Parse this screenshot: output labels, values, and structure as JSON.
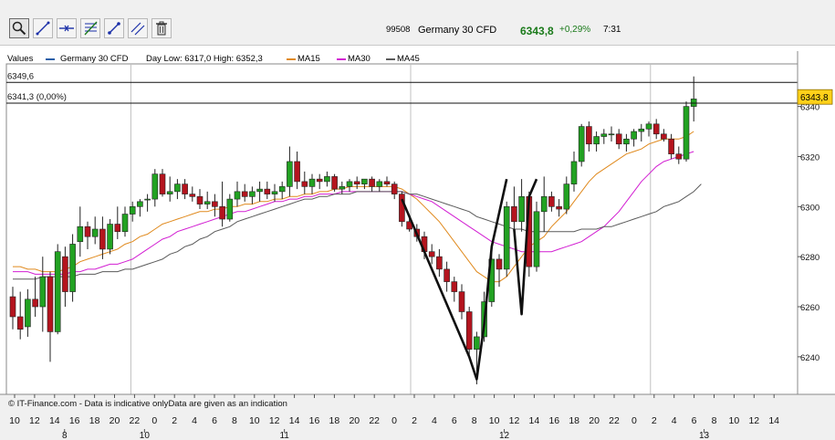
{
  "toolbar": {
    "buttons": [
      {
        "icon": "zoom-select-icon",
        "active": true
      },
      {
        "icon": "trend-line-icon",
        "active": false
      },
      {
        "icon": "horizontal-line-icon",
        "active": false
      },
      {
        "icon": "fibonacci-icon",
        "active": false
      },
      {
        "icon": "zoom-extents-icon",
        "active": false
      },
      {
        "icon": "channel-icon",
        "active": false
      },
      {
        "icon": "trash-icon",
        "active": false
      }
    ]
  },
  "quote": {
    "id": "99508",
    "name": "Germany 30 CFD",
    "last": "6343,8",
    "change": "+0,29%",
    "time": "7:31"
  },
  "legend": {
    "values_label": "Values",
    "instrument": "Germany 30 CFD",
    "day_range": "Day Low: 6317,0 High: 6352,3",
    "ma15": "MA15",
    "ma30": "MA30",
    "ma45": "MA45"
  },
  "colors": {
    "up_candle": "#22a222",
    "down_candle": "#b4141e",
    "ma15": "#e08a1e",
    "ma30": "#d21ed2",
    "ma45": "#5a5a5a",
    "instrument": "#2a5fa8",
    "price_box": "#ffd11a",
    "annotation": "#101010"
  },
  "chart_data": {
    "type": "candlestick",
    "title": "Germany 30 CFD",
    "ylim": [
      6225,
      6357
    ],
    "y_ticks": [
      6240,
      6260,
      6280,
      6300,
      6320,
      6340
    ],
    "grid": true,
    "price_labels": {
      "current": "6343,8",
      "level_high": "6349,6",
      "level_ref": "6341,3 (0,00%)"
    },
    "reference_lines": [
      6349.6,
      6341.3
    ],
    "x_tick_labels": [
      "10",
      "12",
      "14",
      "16",
      "18",
      "20",
      "22",
      "0",
      "2",
      "4",
      "6",
      "8",
      "10",
      "12",
      "14",
      "16",
      "18",
      "20",
      "22",
      "0",
      "2",
      "4",
      "6",
      "8",
      "10",
      "12",
      "14",
      "16",
      "18",
      "20",
      "22",
      "0",
      "2",
      "4",
      "6",
      "8",
      "10",
      "12",
      "14"
    ],
    "day_labels": [
      {
        "label": "8",
        "tick_index": 2.5
      },
      {
        "label": "10",
        "tick_index": 6.5
      },
      {
        "label": "11",
        "tick_index": 13.5
      },
      {
        "label": "12",
        "tick_index": 24.5
      },
      {
        "label": "13",
        "tick_index": 34.5
      }
    ],
    "session_breaks": [
      6,
      20,
      32
    ],
    "candles": [
      [
        6264,
        6268,
        6251,
        6256
      ],
      [
        6256,
        6266,
        6247,
        6251
      ],
      [
        6252,
        6267,
        6248,
        6263
      ],
      [
        6263,
        6272,
        6256,
        6260
      ],
      [
        6260,
        6280,
        6250,
        6272
      ],
      [
        6272,
        6274,
        6238,
        6250
      ],
      [
        6250,
        6285,
        6249,
        6282
      ],
      [
        6280,
        6284,
        6260,
        6266
      ],
      [
        6266,
        6289,
        6262,
        6285
      ],
      [
        6286,
        6300,
        6280,
        6292
      ],
      [
        6292,
        6294,
        6283,
        6288
      ],
      [
        6288,
        6296,
        6285,
        6291
      ],
      [
        6291,
        6296,
        6279,
        6283
      ],
      [
        6283,
        6295,
        6281,
        6293
      ],
      [
        6293,
        6300,
        6287,
        6290
      ],
      [
        6290,
        6300,
        6288,
        6297
      ],
      [
        6297,
        6302,
        6294,
        6300
      ],
      [
        6300,
        6303,
        6296,
        6302
      ],
      [
        6303,
        6305,
        6298,
        6303
      ],
      [
        6303,
        6315,
        6300,
        6313
      ],
      [
        6313,
        6315,
        6304,
        6305
      ],
      [
        6305,
        6312,
        6302,
        6306
      ],
      [
        6306,
        6311,
        6303,
        6309
      ],
      [
        6309,
        6311,
        6303,
        6305
      ],
      [
        6305,
        6308,
        6302,
        6304
      ],
      [
        6304,
        6307,
        6299,
        6301
      ],
      [
        6301,
        6306,
        6299,
        6302
      ],
      [
        6302,
        6305,
        6296,
        6300
      ],
      [
        6300,
        6310,
        6292,
        6295
      ],
      [
        6295,
        6305,
        6294,
        6303
      ],
      [
        6303,
        6310,
        6300,
        6306
      ],
      [
        6306,
        6309,
        6302,
        6304
      ],
      [
        6304,
        6308,
        6301,
        6306
      ],
      [
        6306,
        6310,
        6302,
        6307
      ],
      [
        6307,
        6310,
        6303,
        6305
      ],
      [
        6305,
        6309,
        6302,
        6306
      ],
      [
        6306,
        6310,
        6303,
        6308
      ],
      [
        6308,
        6324,
        6304,
        6318
      ],
      [
        6318,
        6322,
        6307,
        6310
      ],
      [
        6310,
        6314,
        6305,
        6308
      ],
      [
        6308,
        6313,
        6305,
        6311
      ],
      [
        6311,
        6313,
        6307,
        6310
      ],
      [
        6310,
        6314,
        6308,
        6312
      ],
      [
        6312,
        6313,
        6306,
        6307
      ],
      [
        6307,
        6310,
        6305,
        6308
      ],
      [
        6308,
        6311,
        6306,
        6310
      ],
      [
        6310,
        6312,
        6307,
        6309
      ],
      [
        6309,
        6311,
        6307,
        6311
      ],
      [
        6311,
        6312,
        6306,
        6308
      ],
      [
        6308,
        6311,
        6306,
        6310
      ],
      [
        6310,
        6312,
        6308,
        6309
      ],
      [
        6309,
        6310,
        6303,
        6305
      ],
      [
        6305,
        6306,
        6292,
        6294
      ],
      [
        6294,
        6296,
        6290,
        6291
      ],
      [
        6291,
        6293,
        6286,
        6288
      ],
      [
        6288,
        6290,
        6279,
        6282
      ],
      [
        6282,
        6285,
        6277,
        6280
      ],
      [
        6280,
        6283,
        6272,
        6275
      ],
      [
        6275,
        6278,
        6266,
        6270
      ],
      [
        6270,
        6272,
        6262,
        6266
      ],
      [
        6266,
        6269,
        6255,
        6258
      ],
      [
        6258,
        6260,
        6240,
        6243
      ],
      [
        6243,
        6250,
        6229,
        6248
      ],
      [
        6248,
        6266,
        6246,
        6262
      ],
      [
        6262,
        6282,
        6260,
        6279
      ],
      [
        6279,
        6281,
        6268,
        6275
      ],
      [
        6275,
        6302,
        6272,
        6300
      ],
      [
        6300,
        6308,
        6288,
        6294
      ],
      [
        6294,
        6311,
        6290,
        6304
      ],
      [
        6304,
        6306,
        6272,
        6276
      ],
      [
        6276,
        6302,
        6274,
        6298
      ],
      [
        6298,
        6312,
        6290,
        6304
      ],
      [
        6304,
        6306,
        6298,
        6300
      ],
      [
        6300,
        6303,
        6296,
        6299
      ],
      [
        6299,
        6312,
        6297,
        6309
      ],
      [
        6309,
        6322,
        6306,
        6318
      ],
      [
        6318,
        6333,
        6316,
        6332
      ],
      [
        6332,
        6334,
        6322,
        6325
      ],
      [
        6325,
        6330,
        6322,
        6328
      ],
      [
        6328,
        6331,
        6325,
        6329
      ],
      [
        6329,
        6332,
        6326,
        6329
      ],
      [
        6329,
        6331,
        6323,
        6325
      ],
      [
        6325,
        6329,
        6322,
        6327
      ],
      [
        6327,
        6331,
        6324,
        6330
      ],
      [
        6330,
        6333,
        6326,
        6331
      ],
      [
        6331,
        6334,
        6328,
        6333
      ],
      [
        6333,
        6335,
        6327,
        6329
      ],
      [
        6329,
        6331,
        6326,
        6327
      ],
      [
        6327,
        6329,
        6319,
        6321
      ],
      [
        6321,
        6324,
        6317,
        6319
      ],
      [
        6319,
        6342,
        6318,
        6340
      ],
      [
        6340,
        6352,
        6334,
        6343
      ]
    ]
  },
  "moving_averages": {
    "ma15": [
      6276,
      6276,
      6275,
      6275,
      6274,
      6274,
      6274,
      6275,
      6276,
      6278,
      6279,
      6280,
      6281,
      6282,
      6283,
      6285,
      6286,
      6288,
      6289,
      6291,
      6293,
      6294,
      6295,
      6296,
      6297,
      6298,
      6298,
      6299,
      6299,
      6300,
      6300,
      6301,
      6301,
      6302,
      6302,
      6303,
      6303,
      6304,
      6304,
      6305,
      6305,
      6306,
      6306,
      6307,
      6307,
      6308,
      6308,
      6308,
      6308,
      6308,
      6308,
      6308,
      6307,
      6305,
      6303,
      6300,
      6297,
      6294,
      6290,
      6286,
      6282,
      6278,
      6274,
      6272,
      6270,
      6270,
      6272,
      6276,
      6280,
      6284,
      6286,
      6288,
      6292,
      6295,
      6298,
      6302,
      6306,
      6310,
      6313,
      6315,
      6317,
      6319,
      6321,
      6322,
      6323,
      6325,
      6326,
      6327,
      6327,
      6327,
      6328,
      6330
    ],
    "ma30": [
      6274,
      6274,
      6274,
      6273,
      6273,
      6273,
      6273,
      6273,
      6274,
      6274,
      6275,
      6275,
      6276,
      6277,
      6277,
      6278,
      6279,
      6281,
      6283,
      6285,
      6287,
      6288,
      6290,
      6291,
      6292,
      6293,
      6294,
      6295,
      6296,
      6297,
      6298,
      6298,
      6299,
      6300,
      6301,
      6302,
      6302,
      6303,
      6303,
      6304,
      6304,
      6305,
      6305,
      6305,
      6306,
      6306,
      6306,
      6306,
      6306,
      6306,
      6306,
      6306,
      6306,
      6305,
      6304,
      6303,
      6302,
      6300,
      6298,
      6296,
      6294,
      6292,
      6290,
      6288,
      6286,
      6285,
      6284,
      6283,
      6282,
      6282,
      6282,
      6282,
      6282,
      6283,
      6284,
      6285,
      6286,
      6288,
      6290,
      6292,
      6295,
      6298,
      6302,
      6306,
      6310,
      6313,
      6316,
      6318,
      6319,
      6320,
      6321,
      6322
    ],
    "ma45": [
      6271,
      6271,
      6271,
      6271,
      6272,
      6272,
      6272,
      6272,
      6272,
      6273,
      6273,
      6273,
      6274,
      6274,
      6274,
      6275,
      6275,
      6276,
      6277,
      6278,
      6279,
      6281,
      6282,
      6284,
      6285,
      6287,
      6288,
      6290,
      6291,
      6292,
      6294,
      6295,
      6296,
      6297,
      6298,
      6299,
      6300,
      6301,
      6302,
      6303,
      6303,
      6304,
      6304,
      6305,
      6305,
      6305,
      6306,
      6306,
      6306,
      6306,
      6306,
      6306,
      6306,
      6305,
      6305,
      6304,
      6303,
      6302,
      6301,
      6300,
      6299,
      6298,
      6296,
      6295,
      6294,
      6293,
      6292,
      6291,
      6291,
      6290,
      6290,
      6290,
      6290,
      6290,
      6290,
      6290,
      6291,
      6291,
      6291,
      6292,
      6292,
      6293,
      6294,
      6295,
      6296,
      6297,
      6298,
      6300,
      6301,
      6302,
      6304,
      6306,
      6309
    ]
  },
  "annotation_path": [
    [
      6303,
      52
    ],
    [
      6240,
      61
    ],
    [
      6231,
      62
    ],
    [
      6253,
      63
    ],
    [
      6284,
      64
    ],
    [
      6311,
      66
    ]
  ],
  "annotation_path2": [
    [
      6291,
      67
    ],
    [
      6257,
      68
    ],
    [
      6304,
      69
    ],
    [
      6311,
      70
    ]
  ],
  "footer": {
    "source": "© IT-Finance.com - Data is indicative only",
    "disclaimer": "Data are given as an indication"
  }
}
